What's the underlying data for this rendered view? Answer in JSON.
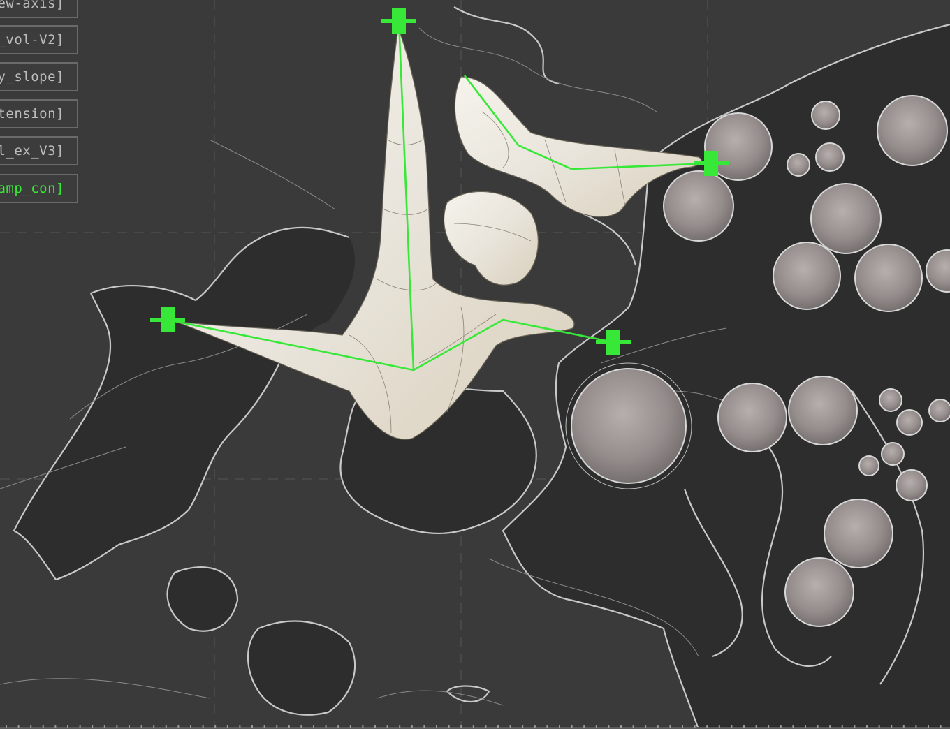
{
  "layers": [
    {
      "label": "ew-axis]",
      "active": false
    },
    {
      "label": "_vol-V2]",
      "active": false
    },
    {
      "label": "y_slope]",
      "active": false
    },
    {
      "label": "tension]",
      "active": false
    },
    {
      "label": "l_ex_V3]",
      "active": false
    },
    {
      "label": "amp_con]",
      "active": true
    }
  ],
  "colors": {
    "background": "#3a3a3a",
    "dark_region": "#2c2c2c",
    "contour": "#c8c8c8",
    "control_green": "#38e838",
    "form_surface": "#ece8df",
    "sphere": "#9a9392"
  },
  "icons": [
    "control-handle-icon",
    "control-handle-icon",
    "control-handle-icon",
    "control-handle-icon"
  ]
}
